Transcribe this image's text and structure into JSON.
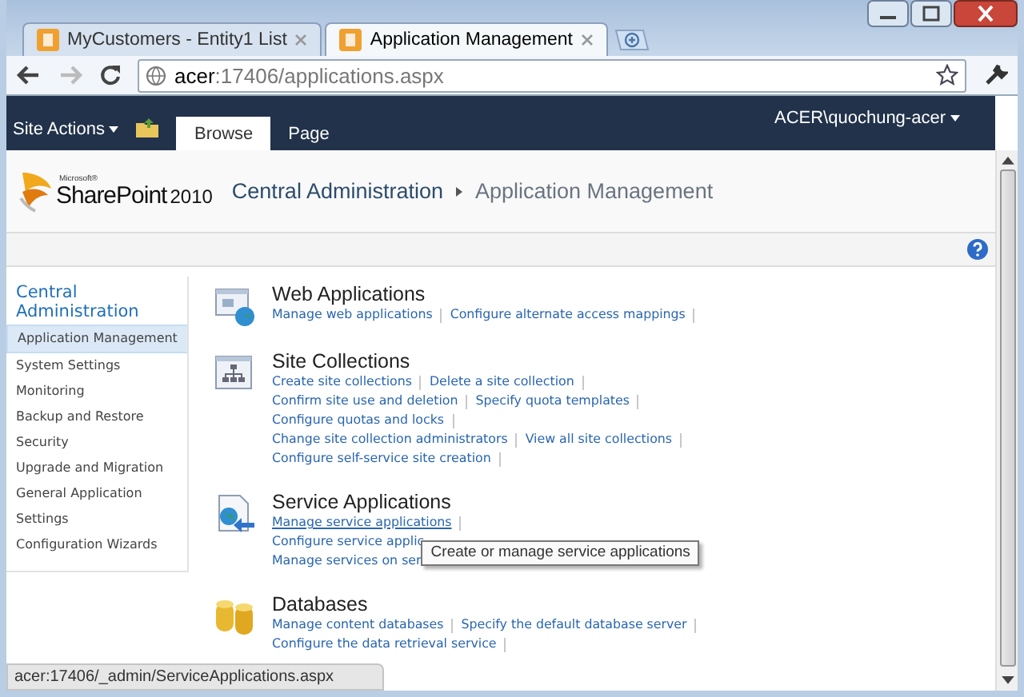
{
  "browser": {
    "tabs": [
      {
        "label": "MyCustomers - Entity1 List",
        "selected": false
      },
      {
        "label": "Application Management",
        "selected": true
      }
    ],
    "address": {
      "host": "acer",
      "path": ":17406/applications.aspx"
    }
  },
  "ribbon": {
    "site_actions": "Site Actions",
    "tabs": [
      {
        "label": "Browse",
        "selected": true
      },
      {
        "label": "Page",
        "selected": false
      }
    ],
    "user": "ACER\\quochung-acer"
  },
  "header": {
    "logo_small": "Microsoft®",
    "logo_name": "SharePoint",
    "logo_version": "2010",
    "breadcrumb": [
      "Central Administration",
      "Application Management"
    ]
  },
  "sidebar": {
    "heading": "Central Administration",
    "items": [
      {
        "label": "Application Management",
        "selected": true
      },
      {
        "label": "System Settings",
        "selected": false
      },
      {
        "label": "Monitoring",
        "selected": false
      },
      {
        "label": "Backup and Restore",
        "selected": false
      },
      {
        "label": "Security",
        "selected": false
      },
      {
        "label": "Upgrade and Migration",
        "selected": false
      },
      {
        "label": "General Application Settings",
        "selected": false
      },
      {
        "label": "Configuration Wizards",
        "selected": false
      }
    ]
  },
  "sections": [
    {
      "kind": "web",
      "title": "Web Applications",
      "lines": [
        [
          "Manage web applications",
          "Configure alternate access mappings"
        ]
      ]
    },
    {
      "kind": "sites",
      "title": "Site Collections",
      "lines": [
        [
          "Create site collections",
          "Delete a site collection"
        ],
        [
          "Confirm site use and deletion",
          "Specify quota templates"
        ],
        [
          "Configure quotas and locks"
        ],
        [
          "Change site collection administrators",
          "View all site collections"
        ],
        [
          "Configure self-service site creation"
        ]
      ]
    },
    {
      "kind": "service",
      "title": "Service Applications",
      "lines": [
        [
          "Manage service applications"
        ],
        [
          "Configure service applic"
        ],
        [
          "Manage services on ser"
        ]
      ]
    },
    {
      "kind": "database",
      "title": "Databases",
      "lines": [
        [
          "Manage content databases",
          "Specify the default database server"
        ],
        [
          "Configure the data retrieval service"
        ]
      ]
    }
  ],
  "tooltip": "Create or manage service applications",
  "status_bar": "acer:17406/_admin/ServiceApplications.aspx"
}
